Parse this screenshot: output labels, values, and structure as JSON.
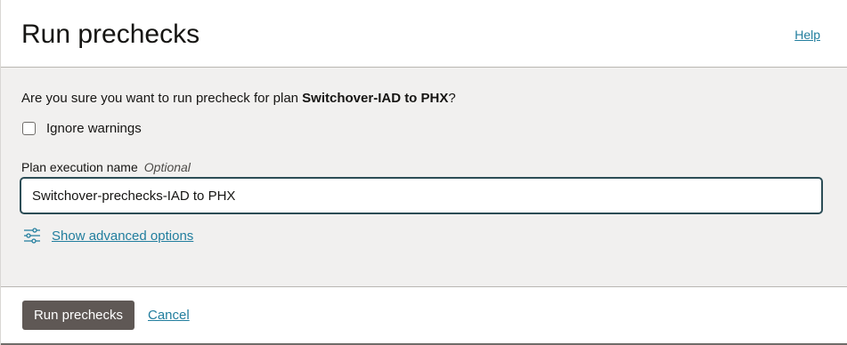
{
  "dialog": {
    "title": "Run prechecks",
    "help_label": "Help"
  },
  "question": {
    "prefix": "Are you sure you want to run precheck for plan ",
    "plan_name": "Switchover-IAD to PHX",
    "suffix": "?"
  },
  "ignore_warnings": {
    "label": "Ignore warnings",
    "checked": false
  },
  "plan_execution": {
    "label": "Plan execution name",
    "optional_label": "Optional",
    "value": "Switchover-prechecks-IAD to PHX"
  },
  "advanced": {
    "label": "Show advanced options",
    "icon": "sliders-icon"
  },
  "footer": {
    "primary_label": "Run prechecks",
    "cancel_label": "Cancel"
  },
  "colors": {
    "link": "#227e9e",
    "primary_button": "#5f5855",
    "body_background": "#f1f0ef"
  }
}
